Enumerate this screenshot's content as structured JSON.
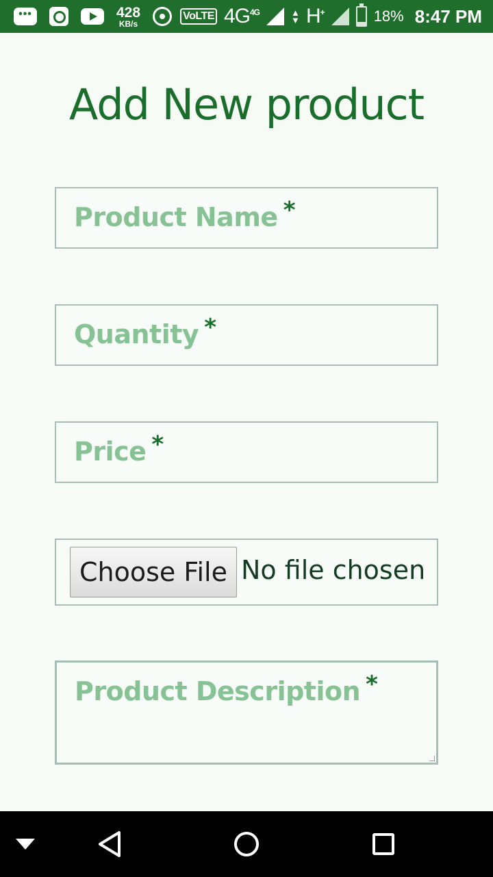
{
  "status_bar": {
    "speed_value": "428",
    "speed_unit": "KB/s",
    "volte_label": "VoLTE",
    "network_primary": "4G",
    "network_primary_sup": "4G",
    "network_secondary": "H",
    "network_secondary_sup": "+",
    "battery_percent": "18%",
    "time": "8:47 PM",
    "icons": [
      "message-icon",
      "sync-icon",
      "youtube-icon",
      "hotspot-icon",
      "signal-icon",
      "data-arrows-icon",
      "battery-icon"
    ],
    "background_color": "#1f6e2b"
  },
  "form": {
    "title": "Add New product",
    "fields": {
      "product_name": {
        "placeholder": "Product Name",
        "required_marker": "*"
      },
      "quantity": {
        "placeholder": "Quantity",
        "required_marker": "*"
      },
      "price": {
        "placeholder": "Price",
        "required_marker": "*"
      },
      "file": {
        "button_label": "Choose File",
        "status": "No file chosen"
      },
      "description": {
        "placeholder": "Product Description",
        "required_marker": "*"
      }
    },
    "colors": {
      "title": "#1a6e2b",
      "placeholder": "#86c294",
      "required": "#1a6e2b",
      "border": "#a8bdb3",
      "background": "#f6fbf6"
    }
  },
  "nav_bar": {
    "icons": [
      "hide-keyboard-icon",
      "back-icon",
      "home-icon",
      "recents-icon"
    ]
  }
}
